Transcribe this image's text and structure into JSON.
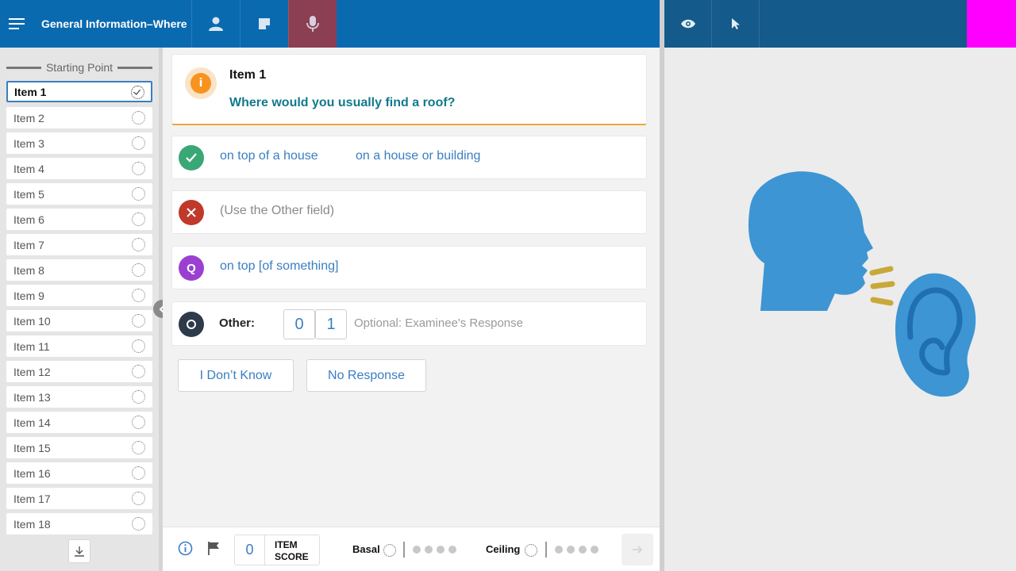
{
  "header": {
    "title": "General Information–Where",
    "buttons": [
      {
        "name": "examinee-button",
        "icon": "person-icon"
      },
      {
        "name": "notes-button",
        "icon": "note-icon"
      },
      {
        "name": "microphone-button",
        "icon": "microphone-icon",
        "active": true
      }
    ],
    "right_buttons": [
      {
        "name": "eye-button",
        "icon": "eye-icon"
      },
      {
        "name": "pointer-button",
        "icon": "cursor-icon"
      }
    ],
    "colors": {
      "left": "#0a6ab0",
      "right": "#145a8a",
      "active": "#8c3f52",
      "accent_block": "#ff00ff"
    }
  },
  "sidebar": {
    "heading": "Starting Point",
    "items": [
      {
        "label": "Item 1",
        "selected": true
      },
      {
        "label": "Item 2"
      },
      {
        "label": "Item 3"
      },
      {
        "label": "Item 4"
      },
      {
        "label": "Item 5"
      },
      {
        "label": "Item 6"
      },
      {
        "label": "Item 7"
      },
      {
        "label": "Item 8"
      },
      {
        "label": "Item 9"
      },
      {
        "label": "Item 10"
      },
      {
        "label": "Item 11"
      },
      {
        "label": "Item 12"
      },
      {
        "label": "Item 13"
      },
      {
        "label": "Item 14"
      },
      {
        "label": "Item 15"
      },
      {
        "label": "Item 16"
      },
      {
        "label": "Item 17"
      },
      {
        "label": "Item 18"
      }
    ]
  },
  "question": {
    "item_label": "Item 1",
    "text": "Where would you usually find a roof?",
    "icon_text": "i"
  },
  "responses": {
    "correct": {
      "options": [
        "on top of a house",
        "on a house or building"
      ],
      "color": "#3aa876"
    },
    "incorrect": {
      "text": "(Use the Other field)",
      "color": "#c0392b"
    },
    "query": {
      "text": "on top [of something]",
      "badge": "Q",
      "color": "#9b3fd1"
    },
    "other": {
      "label": "Other:",
      "score_0": "0",
      "score_1": "1",
      "placeholder": "Optional: Examinee's Response",
      "badge": "O",
      "color": "#2d3a4a"
    }
  },
  "buttons": {
    "dont_know": "I Don’t Know",
    "no_response": "No Response"
  },
  "bottombar": {
    "item_score_value": "0",
    "item_score_label": "ITEM SCORE",
    "basal_label": "Basal",
    "ceiling_label": "Ceiling"
  }
}
